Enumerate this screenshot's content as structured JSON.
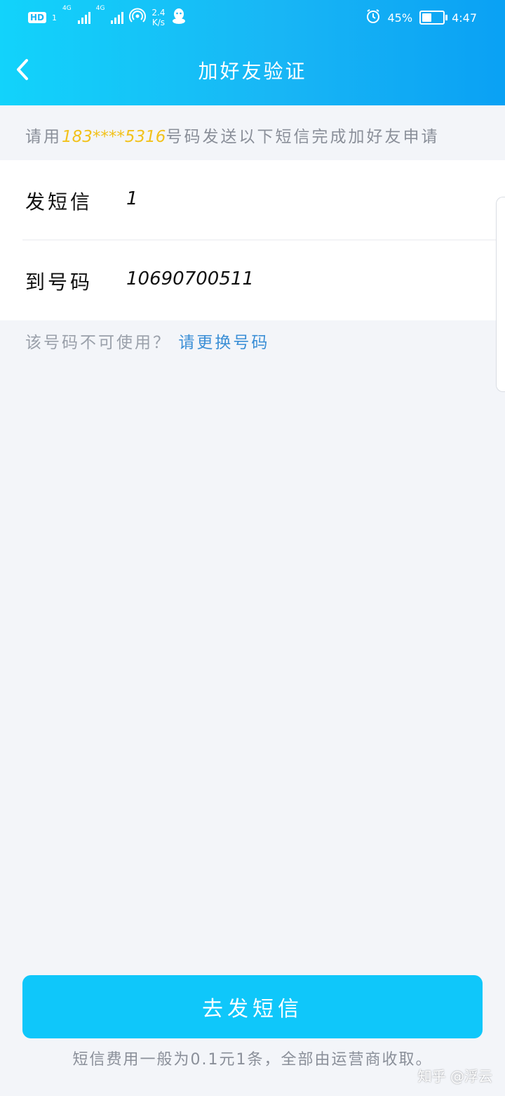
{
  "status_bar": {
    "hd_label": "HD",
    "sim_label": "1",
    "network_1": "4G",
    "network_2": "4G",
    "speed_value": "2.4",
    "speed_unit": "K/s",
    "battery_text": "45%",
    "battery_level": 0.45,
    "time": "4:47"
  },
  "nav": {
    "title": "加好友验证"
  },
  "info": {
    "prefix": "请用",
    "phone": "183****5316",
    "suffix": "号码发送以下短信完成加好友申请"
  },
  "sms": {
    "rows": [
      {
        "label": "发短信",
        "value": "1"
      },
      {
        "label": "到号码",
        "value": "10690700511"
      }
    ]
  },
  "change": {
    "question": "该号码不可使用？",
    "link": "请更换号码"
  },
  "actions": {
    "send_label": "去发短信",
    "fee_note": "短信费用一般为0.1元1条，全部由运营商收取。"
  },
  "watermark": "知乎 @浮云",
  "colors": {
    "header_start": "#12d3fb",
    "header_end": "#0aa1f4",
    "button": "#0fc7fa",
    "phone_highlight": "#f2c21b",
    "link": "#3b8fd6"
  }
}
